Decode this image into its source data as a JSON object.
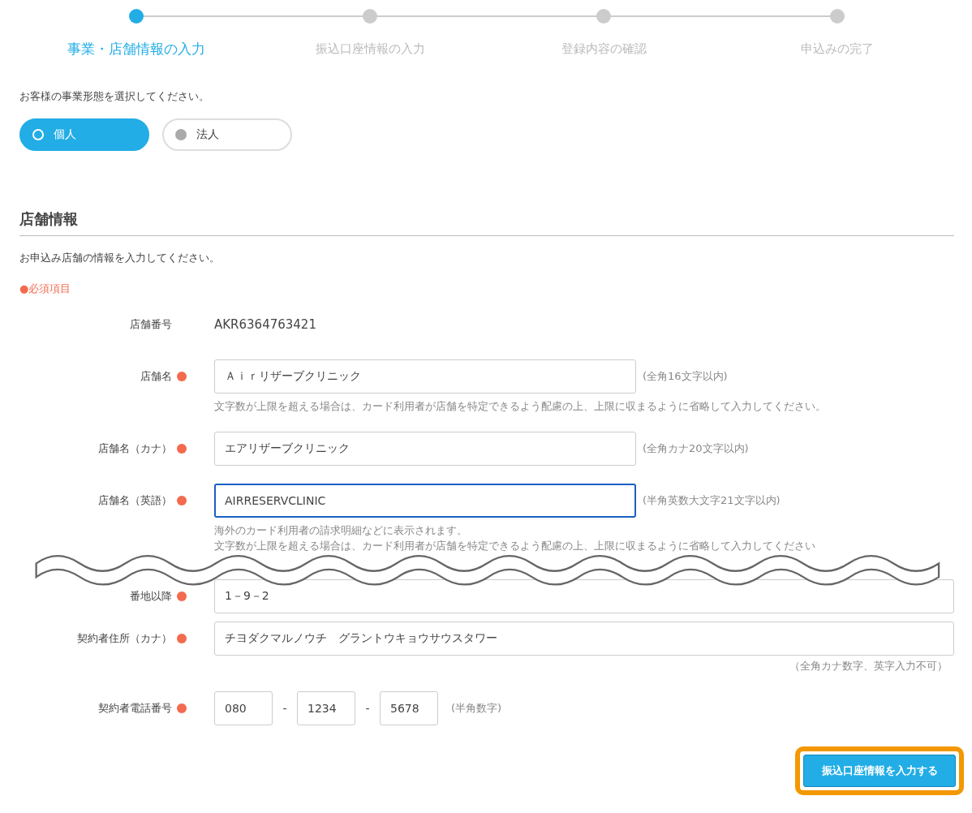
{
  "steps": [
    {
      "label": "事業・店舗情報の入力",
      "selected": true
    },
    {
      "label": "振込口座情報の入力",
      "selected": false
    },
    {
      "label": "登録内容の確認",
      "selected": false
    },
    {
      "label": "申込みの完了",
      "selected": false
    }
  ],
  "business_type": {
    "prompt": "お客様の事業形態を選択してください。",
    "options": [
      {
        "label": "個人",
        "selected": true
      },
      {
        "label": "法人",
        "selected": false
      }
    ]
  },
  "section": {
    "title": "店舗情報",
    "description": "お申込み店舗の情報を入力してください。",
    "required_note": "●必須項目"
  },
  "fields": [
    {
      "kind": "static",
      "label": "店舗番号",
      "required": false,
      "value": "AKR6364763421"
    },
    {
      "kind": "text",
      "label": "店舗名",
      "required": true,
      "value": "Ａｉｒリザーブクリニック",
      "focused": false,
      "hint": "(全角16文字以内)",
      "notes": [
        "文字数が上限を超える場合は、カード利用者が店舗を特定できるよう配慮の上、上限に収まるように省略して入力してください。"
      ]
    },
    {
      "kind": "text",
      "label": "店舗名（カナ）",
      "required": true,
      "value": "エアリザーブクリニック",
      "focused": false,
      "hint": "(全角カナ20文字以内)"
    },
    {
      "kind": "text",
      "label": "店舗名（英語）",
      "required": true,
      "value": "AIRRESERVCLINIC",
      "focused": true,
      "hint": "(半角英数大文字21文字以内)",
      "notes": [
        "海外のカード利用者の請求明細などに表示されます。",
        "文字数が上限を超える場合は、カード利用者が店舗を特定できるよう配慮の上、上限に収まるように省略して入力してください"
      ]
    }
  ],
  "fields_after_break": [
    {
      "kind": "wide",
      "label": "番地以降",
      "required": true,
      "value": "1－9－2",
      "focused": false
    },
    {
      "kind": "wide",
      "label": "契約者住所（カナ）",
      "required": true,
      "value": "チヨダクマルノウチ　グラントウキョウサウスタワー",
      "focused": false,
      "hint_below": "（全角カナ数字、英字入力不可）"
    },
    {
      "kind": "phone",
      "label": "契約者電話番号",
      "required": true,
      "parts": [
        "080",
        "1234",
        "5678"
      ],
      "separators": [
        "-",
        "-"
      ],
      "hint": "(半角数字)"
    }
  ],
  "submit": {
    "label": "振込口座情報を入力する",
    "highlighted": true
  }
}
